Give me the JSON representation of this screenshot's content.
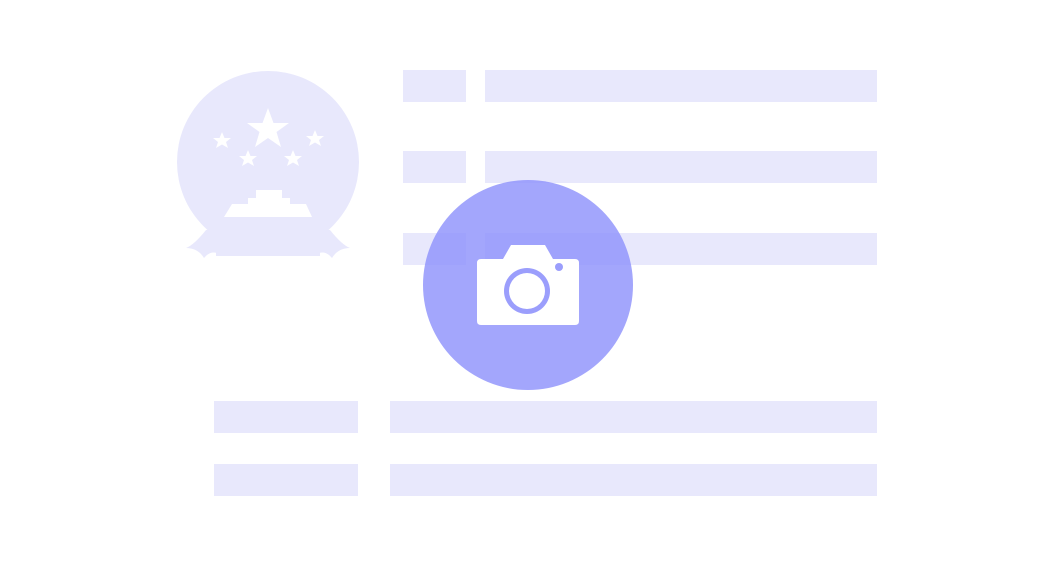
{
  "colors": {
    "placeholder": "#e8e8fc",
    "accent": "#8f92fb",
    "white": "#ffffff"
  },
  "icons": {
    "emblem": "national-emblem-icon",
    "camera": "camera-icon"
  },
  "camera_button": {
    "action": "upload-id-card-photo",
    "opacity": 0.82
  }
}
